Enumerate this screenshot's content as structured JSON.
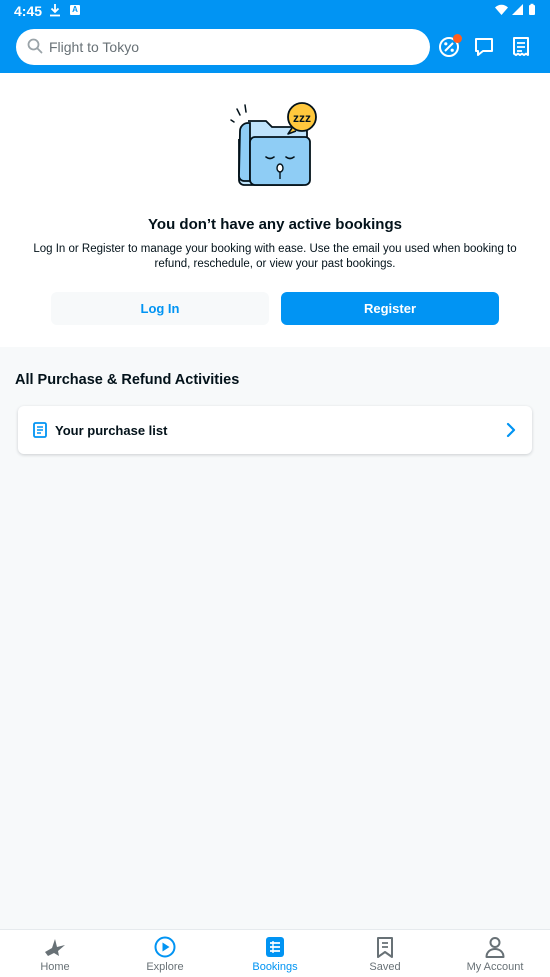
{
  "status_bar": {
    "time": "4:45"
  },
  "header": {
    "search_placeholder": "Flight to Tokyo",
    "icons": [
      "promo-icon",
      "chat-icon",
      "receipt-icon"
    ]
  },
  "empty_state": {
    "title": "You don’t have any active bookings",
    "description": "Log In or Register to manage your booking with ease. Use the email you used when booking to refund, reschedule, or view your past bookings.",
    "login_label": "Log In",
    "register_label": "Register"
  },
  "activities": {
    "section_title": "All Purchase & Refund Activities",
    "purchase_list_label": "Your purchase list"
  },
  "bottom_nav": {
    "items": [
      {
        "label": "Home",
        "icon": "home-icon",
        "active": false
      },
      {
        "label": "Explore",
        "icon": "explore-icon",
        "active": false
      },
      {
        "label": "Bookings",
        "icon": "bookings-icon",
        "active": true
      },
      {
        "label": "Saved",
        "icon": "saved-icon",
        "active": false
      },
      {
        "label": "My Account",
        "icon": "account-icon",
        "active": false
      }
    ]
  },
  "colors": {
    "brand_blue": "#0194f3",
    "notification_orange": "#ff5e1f",
    "text_dark": "#03121a",
    "text_muted": "#687176",
    "background": "#f7f9fa"
  }
}
